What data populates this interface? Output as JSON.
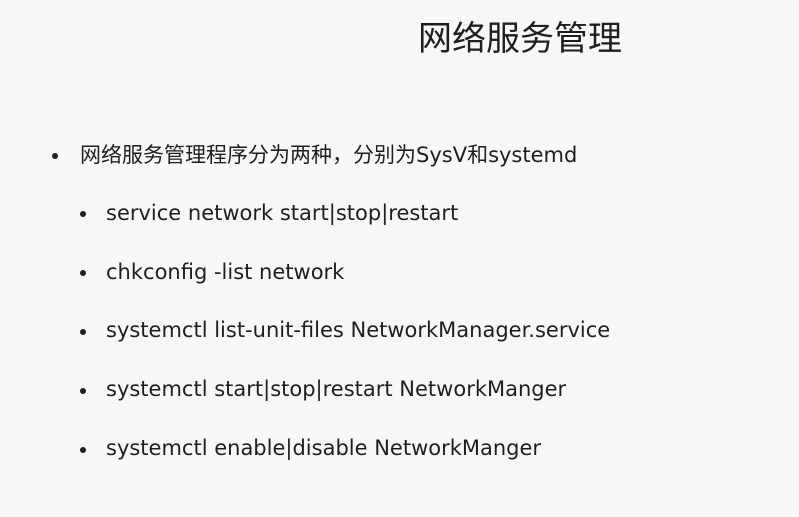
{
  "slide": {
    "title": "网络服务管理",
    "main_bullet": "网络服务管理程序分为两种，分别为SysV和systemd",
    "sub_bullets": [
      "service network start|stop|restart",
      "chkconfig -list network",
      "systemctl list-unit-files  NetworkManager.service",
      "systemctl start|stop|restart NetworkManger",
      "systemctl enable|disable NetworkManger"
    ]
  }
}
